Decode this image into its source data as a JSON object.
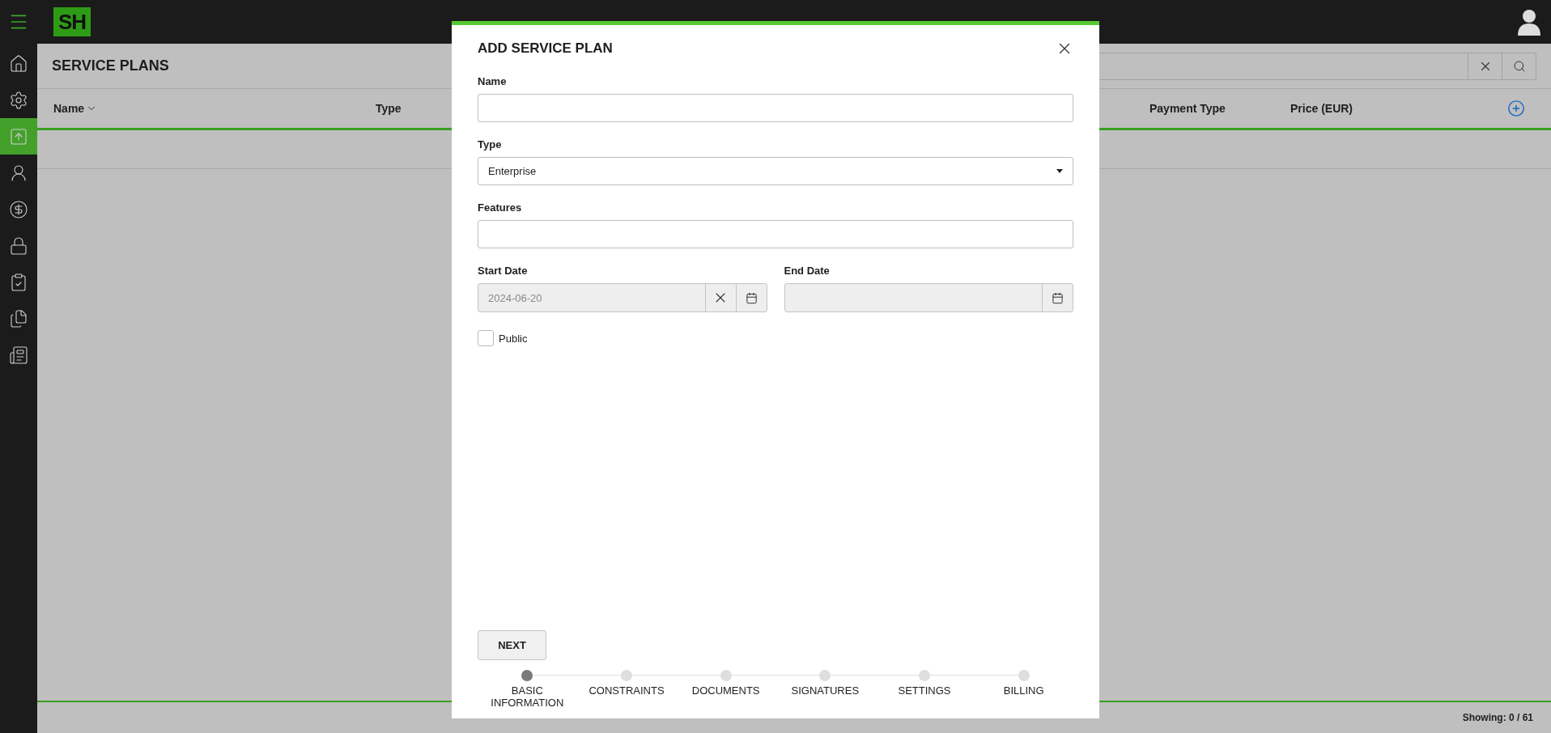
{
  "app": {
    "logo": "SH"
  },
  "sidebar": {
    "items": [
      {
        "selected": false
      },
      {
        "selected": false
      },
      {
        "selected": true
      },
      {
        "selected": false
      },
      {
        "selected": false
      },
      {
        "selected": false
      },
      {
        "selected": false
      },
      {
        "selected": false
      },
      {
        "selected": false
      }
    ]
  },
  "page": {
    "title": "SERVICE PLANS"
  },
  "table": {
    "columns": [
      {
        "label": "Name",
        "sorted": true
      },
      {
        "label": "Type",
        "sorted": false
      },
      {
        "label": "Payment Type",
        "sorted": false
      },
      {
        "label": "Price (EUR)",
        "sorted": false
      }
    ]
  },
  "status_bar": {
    "showing": "Showing: 0 / 61"
  },
  "modal": {
    "title": "ADD SERVICE PLAN",
    "fields": [
      {
        "kind": "text",
        "label": "Name"
      },
      {
        "kind": "select",
        "label": "Type",
        "value": "Enterprise"
      },
      {
        "kind": "text",
        "label": "Features"
      }
    ],
    "dates": [
      {
        "label": "Start Date",
        "value": "2024-06-20",
        "disabled": true
      },
      {
        "label": "End Date",
        "disabled": true
      }
    ],
    "checkbox": {
      "label": "Public",
      "checked": false
    },
    "next_button": "NEXT",
    "steps": [
      {
        "label": "BASIC INFORMATION",
        "selected": true
      },
      {
        "label": "CONSTRAINTS",
        "selected": false
      },
      {
        "label": "DOCUMENTS",
        "selected": false
      },
      {
        "label": "SIGNATURES",
        "selected": false
      },
      {
        "label": "SETTINGS",
        "selected": false
      },
      {
        "label": "BILLING",
        "selected": false
      }
    ]
  }
}
